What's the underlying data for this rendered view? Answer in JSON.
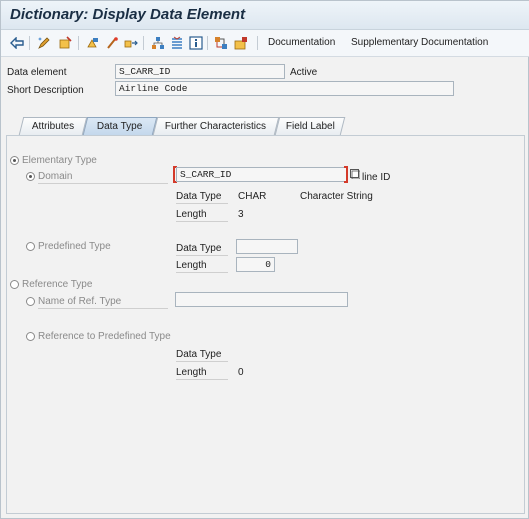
{
  "window": {
    "title": "Dictionary: Display Data Element"
  },
  "toolbar": {
    "icons": [
      "back-icon",
      "display-change-icon",
      "other-object-icon",
      "check-icon",
      "activate-icon",
      "where-used-icon",
      "object-list-icon",
      "display-navigation-icon",
      "info-icon",
      "hierarchy-icon",
      "assign-icon"
    ],
    "documentation_label": "Documentation",
    "supplementary_label": "Supplementary Documentation"
  },
  "header": {
    "data_element_label": "Data element",
    "data_element_value": "S_CARR_ID",
    "status": "Active",
    "short_description_label": "Short Description",
    "short_description_value": "Airline Code"
  },
  "tabs": [
    {
      "label": "Attributes",
      "active": false
    },
    {
      "label": "Data Type",
      "active": true
    },
    {
      "label": "Further Characteristics",
      "active": false
    },
    {
      "label": "Field Label",
      "active": false
    }
  ],
  "data_type_tab": {
    "elementary_type_label": "Elementary Type",
    "domain_label": "Domain",
    "domain_value": "S_CARR_ID",
    "domain_suffix": "line ID",
    "domain_data_type_label": "Data Type",
    "domain_data_type_value": "CHAR",
    "domain_data_type_desc": "Character String",
    "domain_length_label": "Length",
    "domain_length_value": "3",
    "predefined_type_label": "Predefined Type",
    "predefined_data_type_label": "Data Type",
    "predefined_data_type_value": "",
    "predefined_length_label": "Length",
    "predefined_length_value": "0",
    "reference_type_label": "Reference Type",
    "name_of_ref_type_label": "Name of Ref. Type",
    "name_of_ref_type_value": "",
    "ref_predefined_label": "Reference to Predefined Type",
    "ref_data_type_label": "Data Type",
    "ref_length_label": "Length",
    "ref_length_value": "0"
  }
}
